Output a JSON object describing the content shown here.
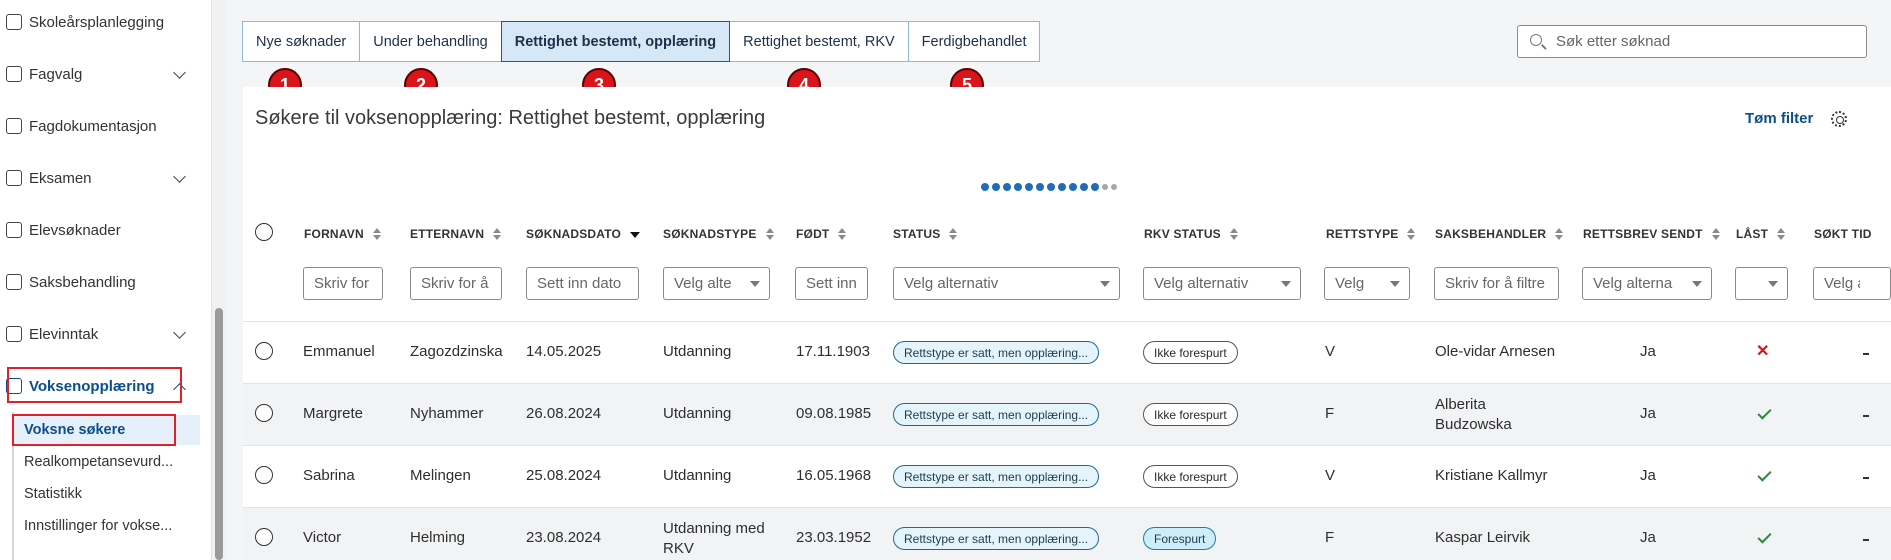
{
  "sidebar": {
    "items": [
      {
        "label": "Skoleårsplanlegging"
      },
      {
        "label": "Fagvalg"
      },
      {
        "label": "Fagdokumentasjon"
      },
      {
        "label": "Eksamen"
      },
      {
        "label": "Elevsøknader"
      },
      {
        "label": "Saksbehandling"
      },
      {
        "label": "Elevinntak"
      },
      {
        "label": "Voksenopplæring"
      }
    ],
    "subitems": [
      {
        "label": "Voksne søkere"
      },
      {
        "label": "Realkompetansevurd..."
      },
      {
        "label": "Statistikk"
      },
      {
        "label": "Innstillinger for vokse..."
      }
    ]
  },
  "tabs": [
    {
      "label": "Nye søknader",
      "badge": "1"
    },
    {
      "label": "Under behandling",
      "badge": "2"
    },
    {
      "label": "Rettighet bestemt, opplæring",
      "badge": "3"
    },
    {
      "label": "Rettighet bestemt, RKV",
      "badge": "4"
    },
    {
      "label": "Ferdigbehandlet",
      "badge": "5"
    }
  ],
  "search": {
    "placeholder": "Søk etter søknad"
  },
  "panel": {
    "title": "Søkere til voksenopplæring: Rettighet bestemt, opplæring",
    "clear_filter": "Tøm filter"
  },
  "columns": [
    {
      "label": "FORNAVN",
      "filter": "Skriv for"
    },
    {
      "label": "ETTERNAVN",
      "filter": "Skriv for å"
    },
    {
      "label": "SØKNADSDATO",
      "filter": "Sett inn dato"
    },
    {
      "label": "SØKNADSTYPE",
      "filter": "Velg alte"
    },
    {
      "label": "FØDT",
      "filter": "Sett inn"
    },
    {
      "label": "STATUS",
      "filter": "Velg alternativ"
    },
    {
      "label": "RKV STATUS",
      "filter": "Velg alternativ"
    },
    {
      "label": "RETTSTYPE",
      "filter": "Velg"
    },
    {
      "label": "SAKSBEHANDLER",
      "filter": "Skriv for å filtre"
    },
    {
      "label": "RETTSBREV SENDT",
      "filter": "Velg alterna"
    },
    {
      "label": "LÅST",
      "filter": ""
    },
    {
      "label": "SØKT TID",
      "filter": "Velg al"
    }
  ],
  "rows": [
    {
      "fornavn": "Emmanuel",
      "etternavn": "Zagozdzinska",
      "dato": "14.05.2025",
      "type": "Utdanning",
      "fodt": "17.11.1903",
      "status": "Rettstype er satt, men opplæring...",
      "rkv": "Ikke forespurt",
      "rettstype": "V",
      "saksbehandler": "Ole-vidar Arnesen",
      "rettsbrev": "Ja",
      "last": "no"
    },
    {
      "fornavn": "Margrete",
      "etternavn": "Nyhammer",
      "dato": "26.08.2024",
      "type": "Utdanning",
      "fodt": "09.08.1985",
      "status": "Rettstype er satt, men opplæring...",
      "rkv": "Ikke forespurt",
      "rettstype": "F",
      "saksbehandler": "Alberita Budzowska",
      "rettsbrev": "Ja",
      "last": "yes"
    },
    {
      "fornavn": "Sabrina",
      "etternavn": "Melingen",
      "dato": "25.08.2024",
      "type": "Utdanning",
      "fodt": "16.05.1968",
      "status": "Rettstype er satt, men opplæring...",
      "rkv": "Ikke forespurt",
      "rettstype": "V",
      "saksbehandler": "Kristiane Kallmyr",
      "rettsbrev": "Ja",
      "last": "yes"
    },
    {
      "fornavn": "Victor",
      "etternavn": "Helming",
      "dato": "23.08.2024",
      "type": "Utdanning med RKV",
      "fodt": "23.03.1952",
      "status": "Rettstype er satt, men opplæring...",
      "rkv": "Forespurt",
      "rettstype": "F",
      "saksbehandler": "Kaspar Leirvik",
      "rettsbrev": "Ja",
      "last": "yes"
    }
  ],
  "colors": {
    "accent": "#0b4f8a",
    "highlight": "#e0202c",
    "badge": "#d9141b"
  }
}
